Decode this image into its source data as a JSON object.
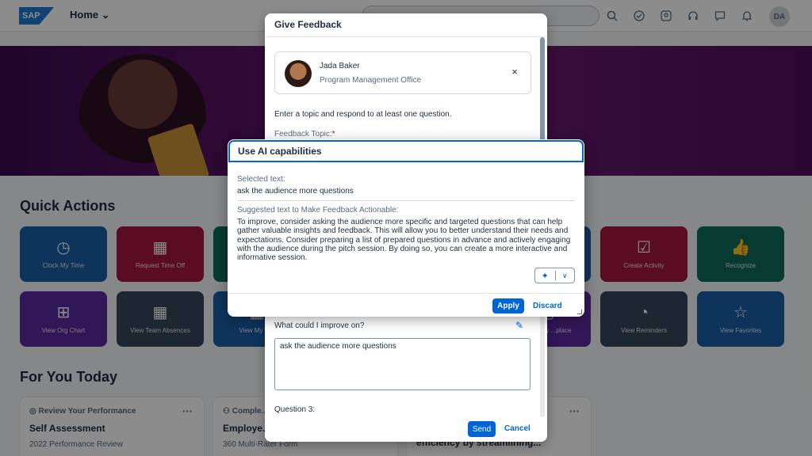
{
  "shell": {
    "logo": "SAP",
    "home_label": "Home",
    "user_initials": "DA"
  },
  "sections": {
    "quick_actions": "Quick Actions",
    "for_you_today": "For You Today"
  },
  "quick_actions": [
    {
      "label": "Clock My Time",
      "color": "#1b5fa8",
      "icon": "clock-plus-icon"
    },
    {
      "label": "Request Time Off",
      "color": "#a5173f",
      "icon": "calendar-icon"
    },
    {
      "label": "",
      "color": "#0e6b5a",
      "icon": "tile-icon"
    },
    {
      "label": "",
      "color": "#5b2aa0",
      "icon": "tile-icon"
    },
    {
      "label": "",
      "color": "#33475a",
      "icon": "tile-icon"
    },
    {
      "label": "",
      "color": "#1b5fa8",
      "icon": "tile-icon"
    },
    {
      "label": "Create Activity",
      "color": "#a5173f",
      "icon": "clipboard-check-icon"
    },
    {
      "label": "Recognize",
      "color": "#0e6b5a",
      "icon": "thumbs-up-icon"
    },
    {
      "label": "View Org Chart",
      "color": "#5b2aa0",
      "icon": "org-chart-icon"
    },
    {
      "label": "View Team Absences",
      "color": "#33475a",
      "icon": "calendar-icon"
    },
    {
      "label": "View My Ti...",
      "color": "#1b5fa8",
      "icon": "calendar-icon"
    },
    {
      "label": "",
      "color": "#0e6b5a",
      "icon": "tile-icon"
    },
    {
      "label": "",
      "color": "#33475a",
      "icon": "tile-icon"
    },
    {
      "label": "...ortunity ...place",
      "color": "#5b2aa0",
      "icon": "tile-icon"
    },
    {
      "label": "View Reminders",
      "color": "#33475a",
      "icon": "reminder-icon"
    },
    {
      "label": "View Favorites",
      "color": "#1b5fa8",
      "icon": "star-list-icon"
    }
  ],
  "cards": [
    {
      "header": "Review Your Performance",
      "title": "Self Assessment",
      "subtitle": "2022 Performance Review"
    },
    {
      "header": "Comple...",
      "title": "Employe...",
      "subtitle": "360 Multi-Rater Form"
    },
    {
      "header": "",
      "title": "efficiency by streamlining...",
      "subtitle": ""
    }
  ],
  "feedback": {
    "title": "Give Feedback",
    "person_name": "Jada Baker",
    "person_role": "Program Management Office",
    "close": "×",
    "intro": "Enter a topic and respond to at least one question.",
    "topic_label": "Feedback Topic:",
    "required": "*",
    "question_improve": "What could I improve on?",
    "answer_improve": "ask the audience more questions",
    "question3": "Question 3:",
    "send": "Send",
    "cancel": "Cancel"
  },
  "ai_dialog": {
    "title": "Use AI capabilities",
    "selected_label": "Selected text:",
    "selected_text": "ask the audience more questions",
    "suggested_label": "Suggested text to Make Feedback Actionable:",
    "suggested_text": "To improve, consider asking the audience more specific and targeted questions that can help gather valuable insights and feedback. This will allow you to better understand their needs and expectations. Consider preparing a list of prepared questions in advance and actively engaging with the audience during the pitch session. By doing so, you can create a more interactive and informative session.",
    "apply": "Apply",
    "discard": "Discard"
  }
}
